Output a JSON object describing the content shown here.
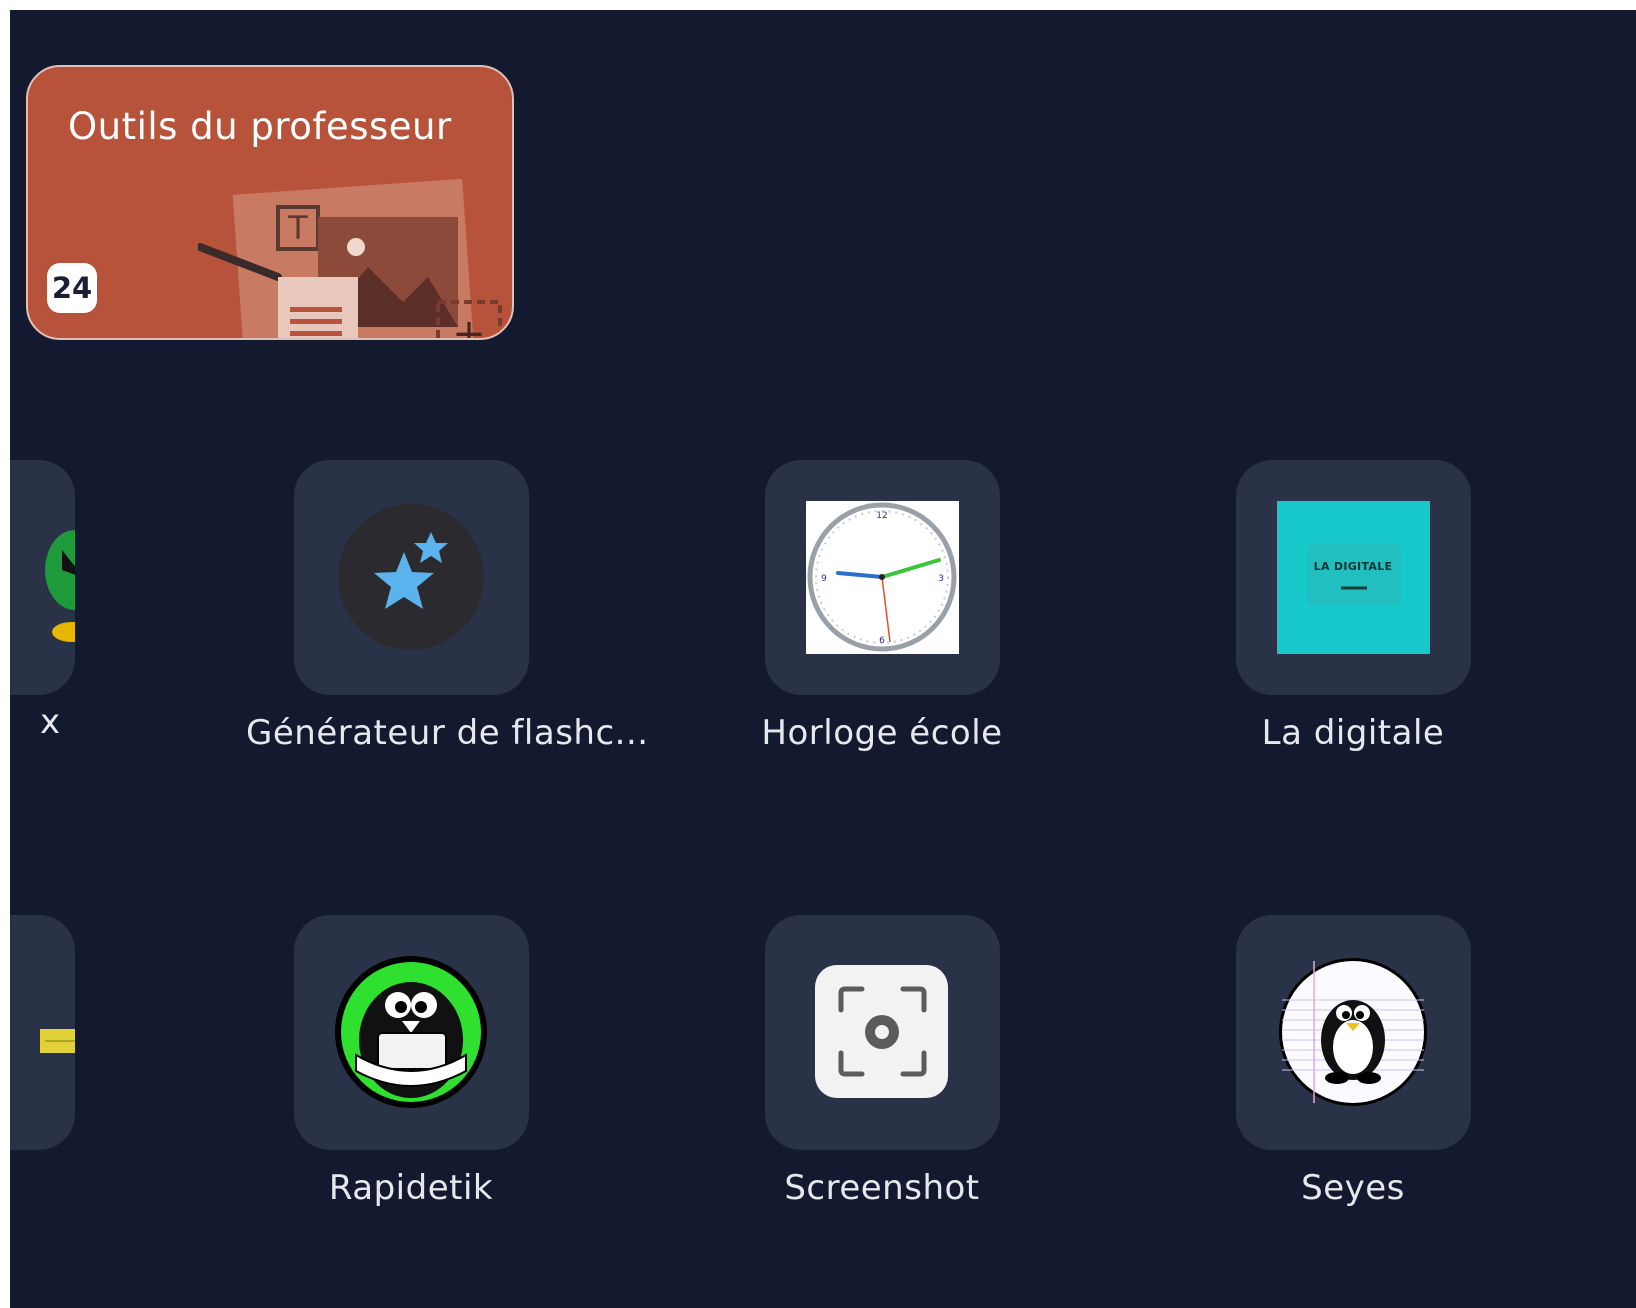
{
  "folder": {
    "title": "Outils du professeur",
    "count": "24",
    "color": "#b7533b"
  },
  "apps": [
    {
      "label": "x",
      "icon": "partial-app-icon",
      "visible": "partial"
    },
    {
      "label": "Générateur de flashc...",
      "icon": "flashcard-stars-icon"
    },
    {
      "label": "Horloge école",
      "icon": "clock-icon"
    },
    {
      "label": "La digitale",
      "icon": "la-digitale-icon",
      "icon_text": "LA DIGITALE"
    },
    {
      "label": "",
      "icon": "partial-app-icon",
      "visible": "partial"
    },
    {
      "label": "Rapidetik",
      "icon": "penguin-green-icon"
    },
    {
      "label": "Screenshot",
      "icon": "screenshot-icon"
    },
    {
      "label": "Seyes",
      "icon": "penguin-seyes-icon"
    }
  ],
  "colors": {
    "background": "#131a2f",
    "tile": "#2a3247",
    "label": "#e6e8ee"
  }
}
